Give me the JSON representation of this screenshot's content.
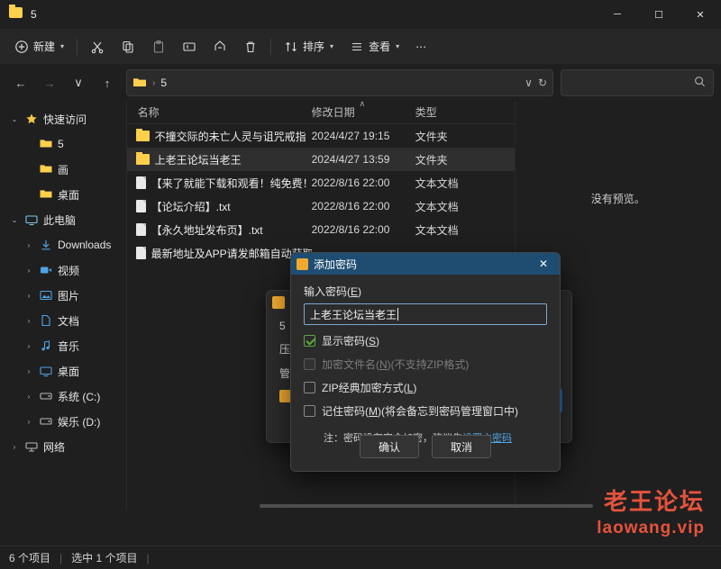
{
  "window": {
    "title": "5",
    "minimize": "─",
    "maximize": "☐",
    "close": "✕"
  },
  "commandbar": {
    "new_label": "新建",
    "cut": "cut-icon",
    "copy": "copy-icon",
    "paste": "paste-icon",
    "rename": "rename-icon",
    "share": "share-icon",
    "delete": "delete-icon",
    "sort_label": "排序",
    "view_label": "查看",
    "more_label": "⋯"
  },
  "navbar": {
    "back": "←",
    "forward": "→",
    "recent": "∨",
    "up": "↑",
    "path_root": "5",
    "path_sep": "›",
    "dropdown": "∨",
    "refresh": "↻",
    "search_placeholder": "",
    "search_icon": "🔍"
  },
  "sidebar": {
    "items": [
      {
        "label": "快速访问",
        "twisty": "⌄",
        "icon": "star-icon",
        "level": 0
      },
      {
        "label": "5",
        "twisty": "",
        "icon": "folder-icon",
        "level": 1
      },
      {
        "label": "画",
        "twisty": "",
        "icon": "folder-icon",
        "level": 1
      },
      {
        "label": "桌面",
        "twisty": "",
        "icon": "folder-icon",
        "level": 1
      },
      {
        "label": "此电脑",
        "twisty": "⌄",
        "icon": "pc-icon",
        "level": 0
      },
      {
        "label": "Downloads",
        "twisty": "›",
        "icon": "download-icon",
        "level": 1
      },
      {
        "label": "视频",
        "twisty": "›",
        "icon": "video-icon",
        "level": 1
      },
      {
        "label": "图片",
        "twisty": "›",
        "icon": "pictures-icon",
        "level": 1
      },
      {
        "label": "文档",
        "twisty": "›",
        "icon": "documents-icon",
        "level": 1
      },
      {
        "label": "音乐",
        "twisty": "›",
        "icon": "music-icon",
        "level": 1
      },
      {
        "label": "桌面",
        "twisty": "›",
        "icon": "desktop-icon",
        "level": 1
      },
      {
        "label": "系统 (C:)",
        "twisty": "›",
        "icon": "drive-icon",
        "level": 1
      },
      {
        "label": "娱乐 (D:)",
        "twisty": "›",
        "icon": "drive-icon",
        "level": 1
      },
      {
        "label": "网络",
        "twisty": "›",
        "icon": "network-icon",
        "level": 0
      }
    ]
  },
  "filelist": {
    "columns": [
      "名称",
      "修改日期",
      "类型"
    ],
    "sort_indicator": "∧",
    "rows": [
      {
        "name": "不撞交际的未亡人灵与诅咒戒指",
        "date": "2024/4/27 19:15",
        "type": "文件夹",
        "icon": "folder-icon",
        "selected": false
      },
      {
        "name": "上老王论坛当老王",
        "date": "2024/4/27 13:59",
        "type": "文件夹",
        "icon": "folder-icon",
        "selected": true
      },
      {
        "name": "【来了就能下载和观看！纯免费！】.txt",
        "date": "2022/8/16 22:00",
        "type": "文本文档",
        "icon": "txt-icon",
        "selected": false
      },
      {
        "name": "【论坛介绍】.txt",
        "date": "2022/8/16 22:00",
        "type": "文本文档",
        "icon": "txt-icon",
        "selected": false
      },
      {
        "name": "【永久地址发布页】.txt",
        "date": "2022/8/16 22:00",
        "type": "文本文档",
        "icon": "txt-icon",
        "selected": false
      },
      {
        "name": "最新地址及APP请发邮箱自动获取!",
        "date": "",
        "type": "",
        "icon": "txt-icon",
        "selected": false
      }
    ]
  },
  "preview": {
    "empty_text": "没有预览。"
  },
  "statusbar": {
    "count": "6 个项目",
    "selection": "选中 1 个项目",
    "sep": "|"
  },
  "watermark": {
    "line1": "老王论坛",
    "line2": "laowang.vip"
  },
  "compress_dialog": {
    "title": "",
    "close": "✕",
    "line1": "5",
    "line2": "压缩",
    "line3": "管理",
    "lock_row": "",
    "primary_button": ""
  },
  "password_dialog": {
    "title": "添加密码",
    "close": "✕",
    "input_label_prefix": "输入密码(",
    "input_label_key": "E",
    "input_label_suffix": ")",
    "password_value": "上老王论坛当老王",
    "options": [
      {
        "prefix": "显示密码(",
        "key": "S",
        "suffix": ")",
        "checked": true,
        "disabled": false
      },
      {
        "prefix": "加密文件名(",
        "key": "N",
        "suffix": ")(不支持ZIP格式)",
        "checked": false,
        "disabled": true
      },
      {
        "prefix": "ZIP经典加密方式(",
        "key": "L",
        "suffix": ")",
        "checked": false,
        "disabled": false
      },
      {
        "prefix": "记住密码(",
        "key": "M",
        "suffix": ")(将会备忘到密码管理窗口中)",
        "checked": false,
        "disabled": false
      }
    ],
    "note_prefix": "注：密码没有安全加密，建议先",
    "note_link": "设置主密码",
    "ok_button": "确认",
    "cancel_button": "取消"
  }
}
